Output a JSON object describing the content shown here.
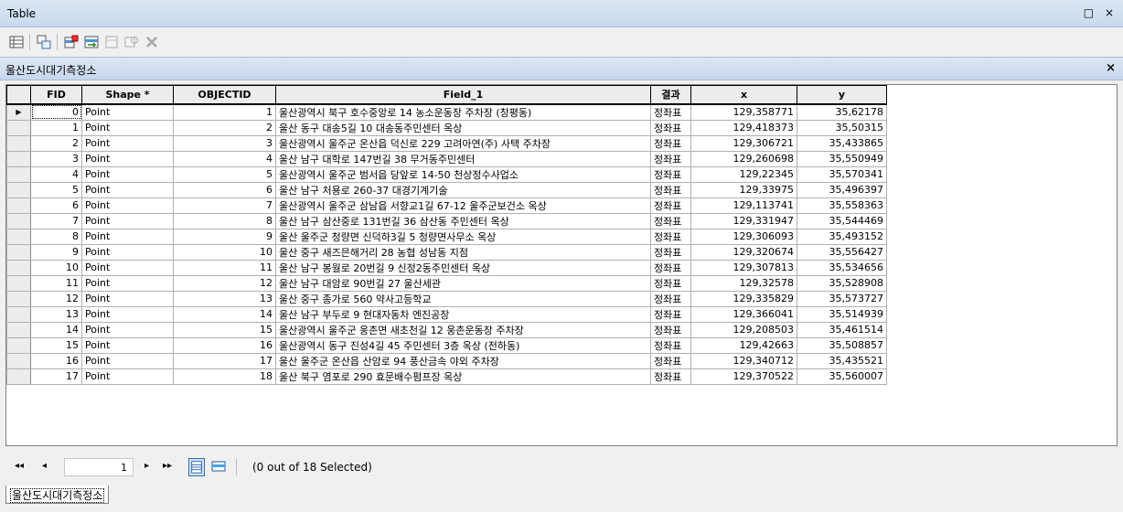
{
  "window": {
    "title": "Table",
    "restore_glyph": "□",
    "close_glyph": "×"
  },
  "toolbar": {
    "icons": [
      "table-options-icon",
      "related-tables-icon",
      "select-by-attributes-icon",
      "switch-selection-icon",
      "clear-selection-icon",
      "zoom-to-selected-icon",
      "delete-selected-icon"
    ]
  },
  "tab": {
    "title": "울산도시대기측정소",
    "close_glyph": "×"
  },
  "table": {
    "columns": [
      "FID",
      "Shape *",
      "OBJECTID",
      "Field_1",
      "결과",
      "x",
      "y"
    ],
    "rows": [
      [
        "0",
        "Point",
        "1",
        "울산광역시 북구 호수중앙로 14 농소운동장 주차장 (창평동)",
        "정좌표",
        "129,358771",
        "35,62178"
      ],
      [
        "1",
        "Point",
        "2",
        "울산 동구 대송5길 10 대송동주민센터 옥상",
        "정좌표",
        "129,418373",
        "35,50315"
      ],
      [
        "2",
        "Point",
        "3",
        "울산광역시 울주군 온산읍 덕신로 229 고려아연(주) 사택 주차장",
        "정좌표",
        "129,306721",
        "35,433865"
      ],
      [
        "3",
        "Point",
        "4",
        "울산 남구 대학로 147번길 38 무거동주민센터",
        "정좌표",
        "129,260698",
        "35,550949"
      ],
      [
        "4",
        "Point",
        "5",
        "울산광역시 울주군 범서읍 당앞로 14-50 천상정수사업소",
        "정좌표",
        "129,22345",
        "35,570341"
      ],
      [
        "5",
        "Point",
        "6",
        "울산 남구 처용로 260-37 대경기계기술",
        "정좌표",
        "129,33975",
        "35,496397"
      ],
      [
        "6",
        "Point",
        "7",
        "울산광역시 울주군 삼남읍 서향교1길 67-12 울주군보건소 옥상",
        "정좌표",
        "129,113741",
        "35,558363"
      ],
      [
        "7",
        "Point",
        "8",
        "울산 남구 삼산중로 131번길 36 삼산동 주민센터 옥상",
        "정좌표",
        "129,331947",
        "35,544469"
      ],
      [
        "8",
        "Point",
        "9",
        "울산 울주군 청량면 신덕하3길 5 청량면사무소 옥상",
        "정좌표",
        "129,306093",
        "35,493152"
      ],
      [
        "9",
        "Point",
        "10",
        "울산 중구 새즈믄해거리 28 농협 성남동 지점",
        "정좌표",
        "129,320674",
        "35,556427"
      ],
      [
        "10",
        "Point",
        "11",
        "울산 남구 봉월로 20번길 9 신정2동주민센터 옥상",
        "정좌표",
        "129,307813",
        "35,534656"
      ],
      [
        "11",
        "Point",
        "12",
        "울산 남구 대암로 90번길 27 울산세관",
        "정좌표",
        "129,32578",
        "35,528908"
      ],
      [
        "12",
        "Point",
        "13",
        "울산 중구 종가로 560 약사고등학교",
        "정좌표",
        "129,335829",
        "35,573727"
      ],
      [
        "13",
        "Point",
        "14",
        "울산 남구 부두로 9 현대자동차 엔진공장",
        "정좌표",
        "129,366041",
        "35,514939"
      ],
      [
        "14",
        "Point",
        "15",
        "울산광역시 울주군 웅촌면 새초천길 12 웅촌운동장 주차장",
        "정좌표",
        "129,208503",
        "35,461514"
      ],
      [
        "15",
        "Point",
        "16",
        "울산광역시 동구 진성4길 45 주민센터 3층 옥상 (전하동)",
        "정좌표",
        "129,42663",
        "35,508857"
      ],
      [
        "16",
        "Point",
        "17",
        "울산 울주군 온산읍 산암로 94 풍산금속 야외 주차장",
        "정좌표",
        "129,340712",
        "35,435521"
      ],
      [
        "17",
        "Point",
        "18",
        "울산 북구 염포로 290 효문배수펌프장 옥상",
        "정좌표",
        "129,370522",
        "35,560007"
      ]
    ]
  },
  "status": {
    "record_number": "1",
    "first_glyph": "◂◂",
    "prev_glyph": "◂",
    "next_glyph": "▸",
    "last_glyph": "▸▸",
    "selection_text": "(0 out of 18 Selected)"
  },
  "bottom_tab": {
    "label": "울산도시대기측정소"
  },
  "colors": {
    "title_bar": "#c9d9ee",
    "grid_border": "#000000",
    "active_view": "#cfe3f7"
  }
}
